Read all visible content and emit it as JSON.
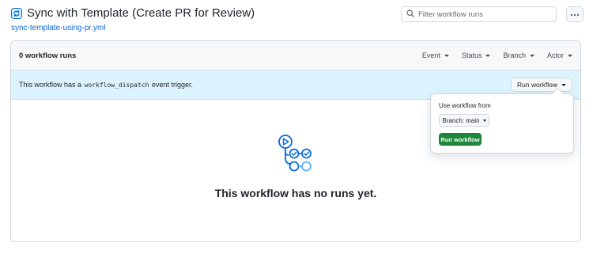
{
  "header": {
    "title": "Sync with Template (Create PR for Review)",
    "workflow_file": "sync-template-using-pr.yml",
    "title_icon": "workflow-icon"
  },
  "search": {
    "placeholder": "Filter workflow runs",
    "value": "",
    "icon": "search-icon"
  },
  "more_menu": {
    "icon": "kebab-horizontal-icon"
  },
  "runs": {
    "count_label": "0 workflow runs",
    "filters": [
      {
        "label": "Event"
      },
      {
        "label": "Status"
      },
      {
        "label": "Branch"
      },
      {
        "label": "Actor"
      }
    ]
  },
  "dispatch": {
    "text_before": "This workflow has a",
    "trigger_code": "workflow_dispatch",
    "text_after": "event trigger.",
    "run_button_label": "Run workflow"
  },
  "popover": {
    "use_from_label": "Use workflow from",
    "branch_button_label": "Branch: main",
    "run_button_label": "Run workflow"
  },
  "empty_state": {
    "title": "This workflow has no runs yet.",
    "illustration": "workflow-graph-icon"
  },
  "colors": {
    "accent": "#0969da",
    "primary_button": "#1f883d",
    "banner_bg": "#ddf4ff",
    "toolbar_bg": "#f6f8fa",
    "illustration_blue": "#0969da",
    "illustration_light": "#54aeff"
  }
}
